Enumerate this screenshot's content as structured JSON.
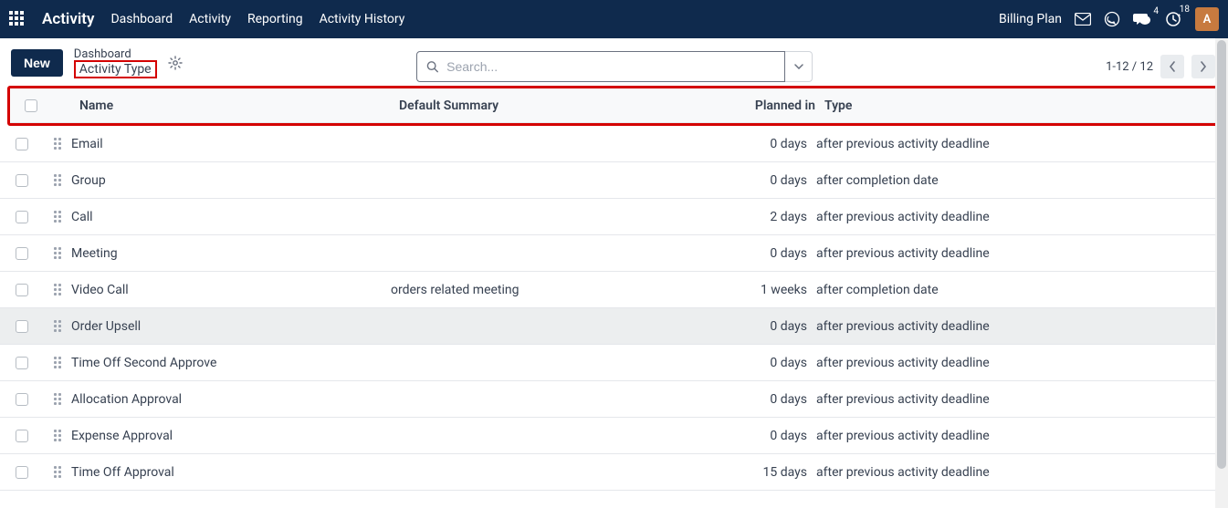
{
  "navbar": {
    "brand": "Activity",
    "links": [
      "Dashboard",
      "Activity",
      "Reporting",
      "Activity History"
    ],
    "billing_label": "Billing Plan",
    "chat_badge": "4",
    "clock_badge": "18",
    "avatar_letter": "A"
  },
  "controlbar": {
    "new_label": "New",
    "crumb_top": "Dashboard",
    "crumb_bottom": "Activity Type",
    "search_placeholder": "Search...",
    "pager_text": "1-12 / 12"
  },
  "table": {
    "headers": {
      "name": "Name",
      "summary": "Default Summary",
      "planned": "Planned in",
      "type": "Type"
    },
    "rows": [
      {
        "name": "Email",
        "summary": "",
        "planned": "0 days",
        "type": "after previous activity deadline"
      },
      {
        "name": "Group",
        "summary": "",
        "planned": "0 days",
        "type": "after completion date"
      },
      {
        "name": "Call",
        "summary": "",
        "planned": "2 days",
        "type": "after previous activity deadline"
      },
      {
        "name": "Meeting",
        "summary": "",
        "planned": "0 days",
        "type": "after previous activity deadline"
      },
      {
        "name": "Video Call",
        "summary": "orders related meeting",
        "planned": "1 weeks",
        "type": "after completion date"
      },
      {
        "name": "Order Upsell",
        "summary": "",
        "planned": "0 days",
        "type": "after previous activity deadline",
        "hovered": true
      },
      {
        "name": "Time Off Second Approve",
        "summary": "",
        "planned": "0 days",
        "type": "after previous activity deadline"
      },
      {
        "name": "Allocation Approval",
        "summary": "",
        "planned": "0 days",
        "type": "after previous activity deadline"
      },
      {
        "name": "Expense Approval",
        "summary": "",
        "planned": "0 days",
        "type": "after previous activity deadline"
      },
      {
        "name": "Time Off Approval",
        "summary": "",
        "planned": "15 days",
        "type": "after previous activity deadline"
      }
    ]
  }
}
